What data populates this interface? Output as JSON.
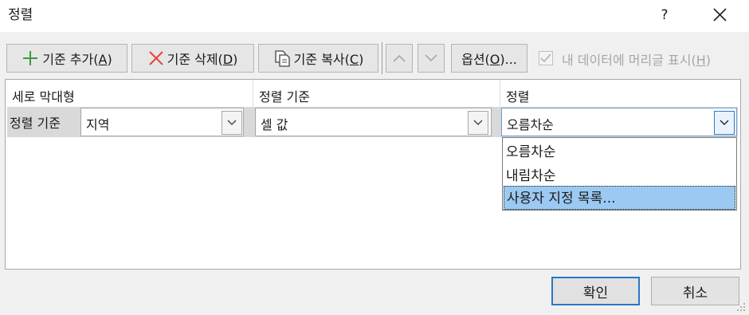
{
  "window": {
    "title": "정렬",
    "help_label": "?",
    "close_icon": "close-icon"
  },
  "toolbar": {
    "add": {
      "label": "기준 추가(",
      "accel": "A",
      "tail": ")",
      "icon": "plus-icon"
    },
    "delete": {
      "label": "기준 삭제(",
      "accel": "D",
      "tail": ")",
      "icon": "x-icon"
    },
    "copy": {
      "label": "기준 복사(",
      "accel": "C",
      "tail": ")",
      "icon": "copy-icon"
    },
    "move_up_icon": "chevron-up-icon",
    "move_down_icon": "chevron-down-icon",
    "options": {
      "label": "옵션(",
      "accel": "O",
      "tail": ")..."
    },
    "headers_checkbox": {
      "label": "내 데이터에 머리글 표시(",
      "accel": "H",
      "tail": ")",
      "checked": true,
      "disabled": true
    }
  },
  "columns": {
    "col1": "세로 막대형",
    "col2": "정렬 기준",
    "col3": "정렬"
  },
  "rows": [
    {
      "label": "정렬 기준",
      "column_value": "지역",
      "sort_on_value": "셀 값",
      "order_value": "오름차순"
    }
  ],
  "order_dropdown": {
    "options": [
      "오름차순",
      "내림차순",
      "사용자 지정 목록..."
    ],
    "highlighted": "사용자 지정 목록..."
  },
  "buttons": {
    "ok": "확인",
    "cancel": "취소"
  },
  "colors": {
    "accent": "#2877c8",
    "highlight": "#9cc9f2",
    "add_icon": "#3c9a3c",
    "delete_icon": "#e0463c"
  }
}
